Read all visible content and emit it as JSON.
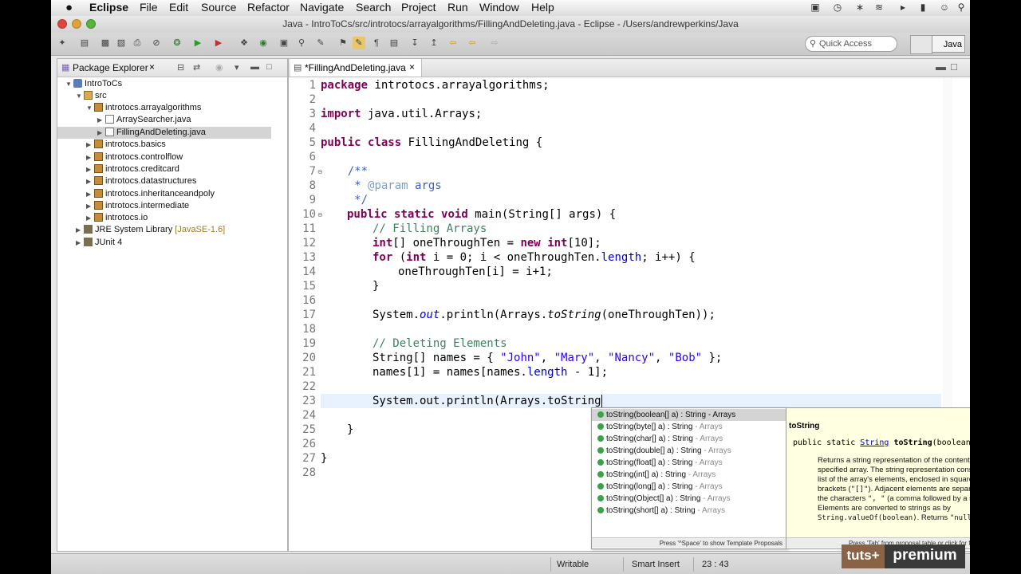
{
  "menubar": {
    "apple": "",
    "app_name": "Eclipse",
    "items": [
      "File",
      "Edit",
      "Source",
      "Refactor",
      "Navigate",
      "Search",
      "Project",
      "Run",
      "Window",
      "Help"
    ]
  },
  "window": {
    "title": "Java - IntroToCs/src/introtocs/arrayalgorithms/FillingAndDeleting.java - Eclipse - /Users/andrewperkins/Java"
  },
  "toolbar": {
    "quick_access_placeholder": "Quick Access",
    "perspective_label": "Java"
  },
  "package_explorer": {
    "title": "Package Explorer",
    "tree": [
      {
        "label": "IntroToCs",
        "level": 0,
        "icon": "project-icon",
        "expanded": true
      },
      {
        "label": "src",
        "level": 1,
        "icon": "source-folder-icon",
        "expanded": true
      },
      {
        "label": "introtocs.arrayalgorithms",
        "level": 2,
        "icon": "package-icon",
        "expanded": true
      },
      {
        "label": "ArraySearcher.java",
        "level": 3,
        "icon": "java-file-icon",
        "expanded": false
      },
      {
        "label": "FillingAndDeleting.java",
        "level": 3,
        "icon": "java-file-icon",
        "expanded": false,
        "selected": true
      },
      {
        "label": "introtocs.basics",
        "level": 2,
        "icon": "package-icon",
        "expanded": false
      },
      {
        "label": "introtocs.controlflow",
        "level": 2,
        "icon": "package-icon",
        "expanded": false
      },
      {
        "label": "introtocs.creditcard",
        "level": 2,
        "icon": "package-icon",
        "expanded": false
      },
      {
        "label": "introtocs.datastructures",
        "level": 2,
        "icon": "package-icon",
        "expanded": false
      },
      {
        "label": "introtocs.inheritanceandpoly",
        "level": 2,
        "icon": "package-icon",
        "expanded": false
      },
      {
        "label": "introtocs.intermediate",
        "level": 2,
        "icon": "package-icon",
        "expanded": false
      },
      {
        "label": "introtocs.io",
        "level": 2,
        "icon": "package-icon",
        "expanded": false
      },
      {
        "label": "JRE System Library",
        "suffix": "[JavaSE-1.6]",
        "level": 1,
        "icon": "library-icon",
        "expanded": false
      },
      {
        "label": "JUnit 4",
        "level": 1,
        "icon": "library-icon",
        "expanded": false
      }
    ]
  },
  "editor": {
    "tab_label": "*FillingAndDeleting.java",
    "line_numbers": [
      "1",
      "2",
      "3",
      "4",
      "5",
      "6",
      "7",
      "8",
      "9",
      "10",
      "11",
      "12",
      "13",
      "14",
      "15",
      "16",
      "17",
      "18",
      "19",
      "20",
      "21",
      "22",
      "23",
      "24",
      "25",
      "26",
      "27",
      "28"
    ],
    "code": {
      "l1_kw": "package",
      "l1_rest": " introtocs.arrayalgorithms;",
      "l3_kw": "import",
      "l3_rest": " java.util.Arrays;",
      "l5_kw1": "public",
      "l5_kw2": "class",
      "l5_rest": " FillingAndDeleting {",
      "l7": "    /**",
      "l8_star": "     * ",
      "l8_tag": "@param",
      "l8_rest": " args",
      "l9": "     */",
      "l10_kw1": "public",
      "l10_kw2": "static",
      "l10_kw3": "void",
      "l10_rest": " main(String[] args) {",
      "l11": "// Filling Arrays",
      "l12_kw1": "int",
      "l12_mid": "[] oneThroughTen = ",
      "l12_kw2": "new",
      "l12_kw3": "int",
      "l12_rest": "[10];",
      "l13_kw1": "for",
      "l13_a": " (",
      "l13_kw2": "int",
      "l13_b": " i = 0; i < oneThroughTen.",
      "l13_fld": "length",
      "l13_c": "; i++) {",
      "l14": "oneThroughTen[i] = i+1;",
      "l15": "}",
      "l17_a": "System.",
      "l17_out": "out",
      "l17_b": ".println(Arrays.",
      "l17_ts": "toString",
      "l17_c": "(oneThroughTen));",
      "l19": "// Deleting Elements",
      "l20_a": "String[] names = { ",
      "l20_s1": "\"John\"",
      "l20_s2": "\"Mary\"",
      "l20_s3": "\"Nancy\"",
      "l20_s4": "\"Bob\"",
      "l20_end": " };",
      "l21_a": "names[1] = names[names.",
      "l21_fld": "length",
      "l21_b": " - 1];",
      "l23": "System.out.println(Arrays.toString",
      "l25": "}",
      "l27": "}"
    }
  },
  "completion": {
    "items": [
      {
        "sig": "toString(boolean[] a) : String",
        "owner": " - Arrays"
      },
      {
        "sig": "toString(byte[] a) : String",
        "owner": " - Arrays"
      },
      {
        "sig": "toString(char[] a) : String",
        "owner": " - Arrays"
      },
      {
        "sig": "toString(double[] a) : String",
        "owner": " - Arrays"
      },
      {
        "sig": "toString(float[] a) : String",
        "owner": " - Arrays"
      },
      {
        "sig": "toString(int[] a) : String",
        "owner": " - Arrays"
      },
      {
        "sig": "toString(long[] a) : String",
        "owner": " - Arrays"
      },
      {
        "sig": "toString(Object[] a) : String",
        "owner": " - Arrays"
      },
      {
        "sig": "toString(short[] a) : String",
        "owner": " - Arrays"
      }
    ],
    "status": "Press '^Space' to show Template Proposals"
  },
  "javadoc": {
    "title": "toString",
    "sig_prefix": "public static ",
    "sig_type": "String",
    "sig_name": "toString",
    "sig_params": "(boolean[] a)",
    "body_1": "Returns a string representation of the contents of the specified array. The string representation consists of a list of the array's elements, enclosed in square brackets (",
    "body_code1": "\"[]\"",
    "body_2": "). Adjacent elements are separated by the characters ",
    "body_code2": "\", \"",
    "body_3": " (a comma followed by a space). Elements are converted to strings as by ",
    "body_code3": "String.valueOf(boolean)",
    "body_4": ". Returns ",
    "body_code4": "\"null\"",
    "status": "Press 'Tab' from proposal table or click for focus"
  },
  "statusbar": {
    "mode": "Writable",
    "insert": "Smart Insert",
    "position": "23 : 43"
  },
  "watermark": {
    "brand": "tuts+",
    "label": "premium"
  }
}
